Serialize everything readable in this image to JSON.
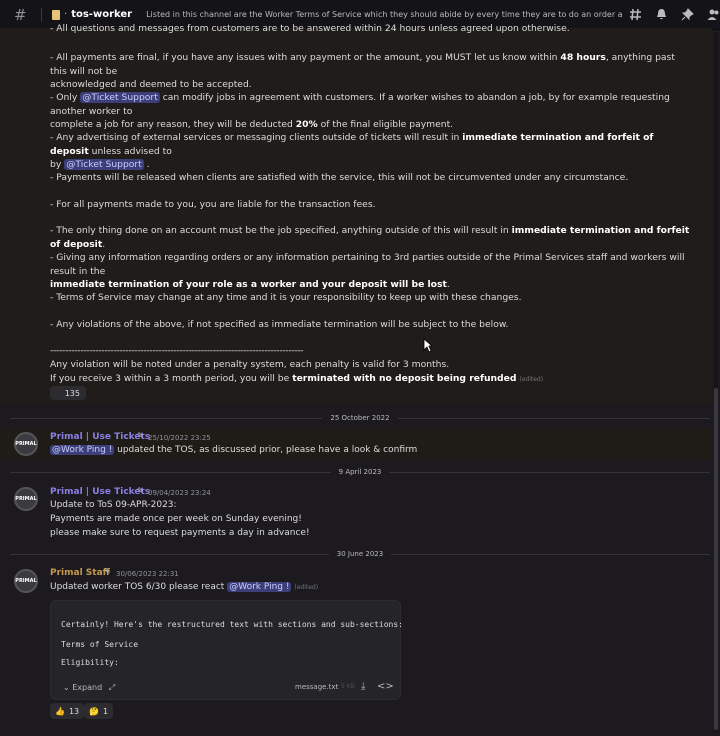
{
  "header": {
    "channel": "tos-worker",
    "topic": "Listed in this channel are the Worker Terms of Service which they should abide by every time they are to do an order and are as a posi..."
  },
  "tos_lines": {
    "l0": "- All questions and messages from customers are to be answered within 24 hours unless agreed upon otherwise.",
    "l1a": "- All payments are final, if you have any issues with any payment or the amount, you MUST let us know within ",
    "l1b": "48 hours",
    "l1c": ", anything past this will not be",
    "l1d": "acknowledged and deemed to be accepted.",
    "l2a": "- Only ",
    "l2m": "@Ticket Support",
    "l2b": " can modify jobs in agreement with customers. If a worker wishes to abandon a job, by for example requesting another worker to",
    "l2c": "complete a job for any reason,  they will be deducted ",
    "l2d": "20%",
    "l2e": " of the final eligible payment.",
    "l3a": "- Any advertising of external services or messaging clients outside of tickets will result in ",
    "l3b": "immediate termination and forfeit of deposit",
    "l3c": " unless advised to",
    "l3d": "by ",
    "l3m": "@Ticket Support",
    "l3e": " .",
    "l4": "- Payments will be released when clients are satisfied with the service, this will not be circumvented under any circumstance.",
    "l5": "- For all payments made to you, you are liable for the transaction fees.",
    "l6a": "- The only thing done on an account must be the job specified, anything outside of this will result in ",
    "l6b": "immediate termination and forfeit of deposit",
    "l6c": ".",
    "l7a": "- Giving any information regarding orders or any information pertaining to 3rd parties outside of the Primal Services staff and workers will result in the",
    "l7b": "immediate termination of your role as a worker and your deposit will be lost",
    "l7c": ".",
    "l8": "- Terms of Service may change at any time and it is your responsibility to keep up with these changes.",
    "l9": "- Any violations of the above, if not specified as immediate termination will be subject to the below.",
    "l10": "------------------------------------------------------------------------------------",
    "l11": " Any violation will be noted under a penalty system, each penalty is valid for 3 months.",
    "l12a": "If you receive 3 within a 3 month period, you will be ",
    "l12b": "terminated with no deposit being refunded",
    "edited": "(edited)",
    "reaction_count": "135"
  },
  "dates": {
    "d1": "25 October 2022",
    "d2": "9 April 2023",
    "d3": "30 June 2023"
  },
  "messages": {
    "m1": {
      "avatar": "PRIMAL",
      "author": "Primal | Use Tickets",
      "time": "25/10/2022 23:25",
      "mention": "@Work Ping !",
      "text": " updated the TOS, as discussed prior, please have a look & confirm"
    },
    "m2": {
      "avatar": "PRIMAL",
      "author": "Primal | Use Tickets",
      "time": "09/04/2023 23:24",
      "line1": "Update to ToS 09-APR-2023:",
      "line2": "Payments are made once per week on Sunday evening!",
      "line3": "please make sure to request payments a day in advance!"
    },
    "m3": {
      "avatar": "PRIMAL",
      "author": "Primal Staff",
      "time": "30/06/2023 22:31",
      "text": "Updated worker TOS 6/30 please react ",
      "mention": "@Work Ping !",
      "edited": "(edited)",
      "attachment": {
        "line1": "Certainly! Here's the restructured text with sections and sub-sections:",
        "line2": "Terms of Service",
        "line3": "Eligibility:",
        "expand": "Expand",
        "filename": "message.txt",
        "size": "5 KB"
      },
      "reactions": [
        {
          "emoji": "👍",
          "count": "13"
        },
        {
          "emoji": "🤔",
          "count": "1"
        }
      ]
    }
  }
}
